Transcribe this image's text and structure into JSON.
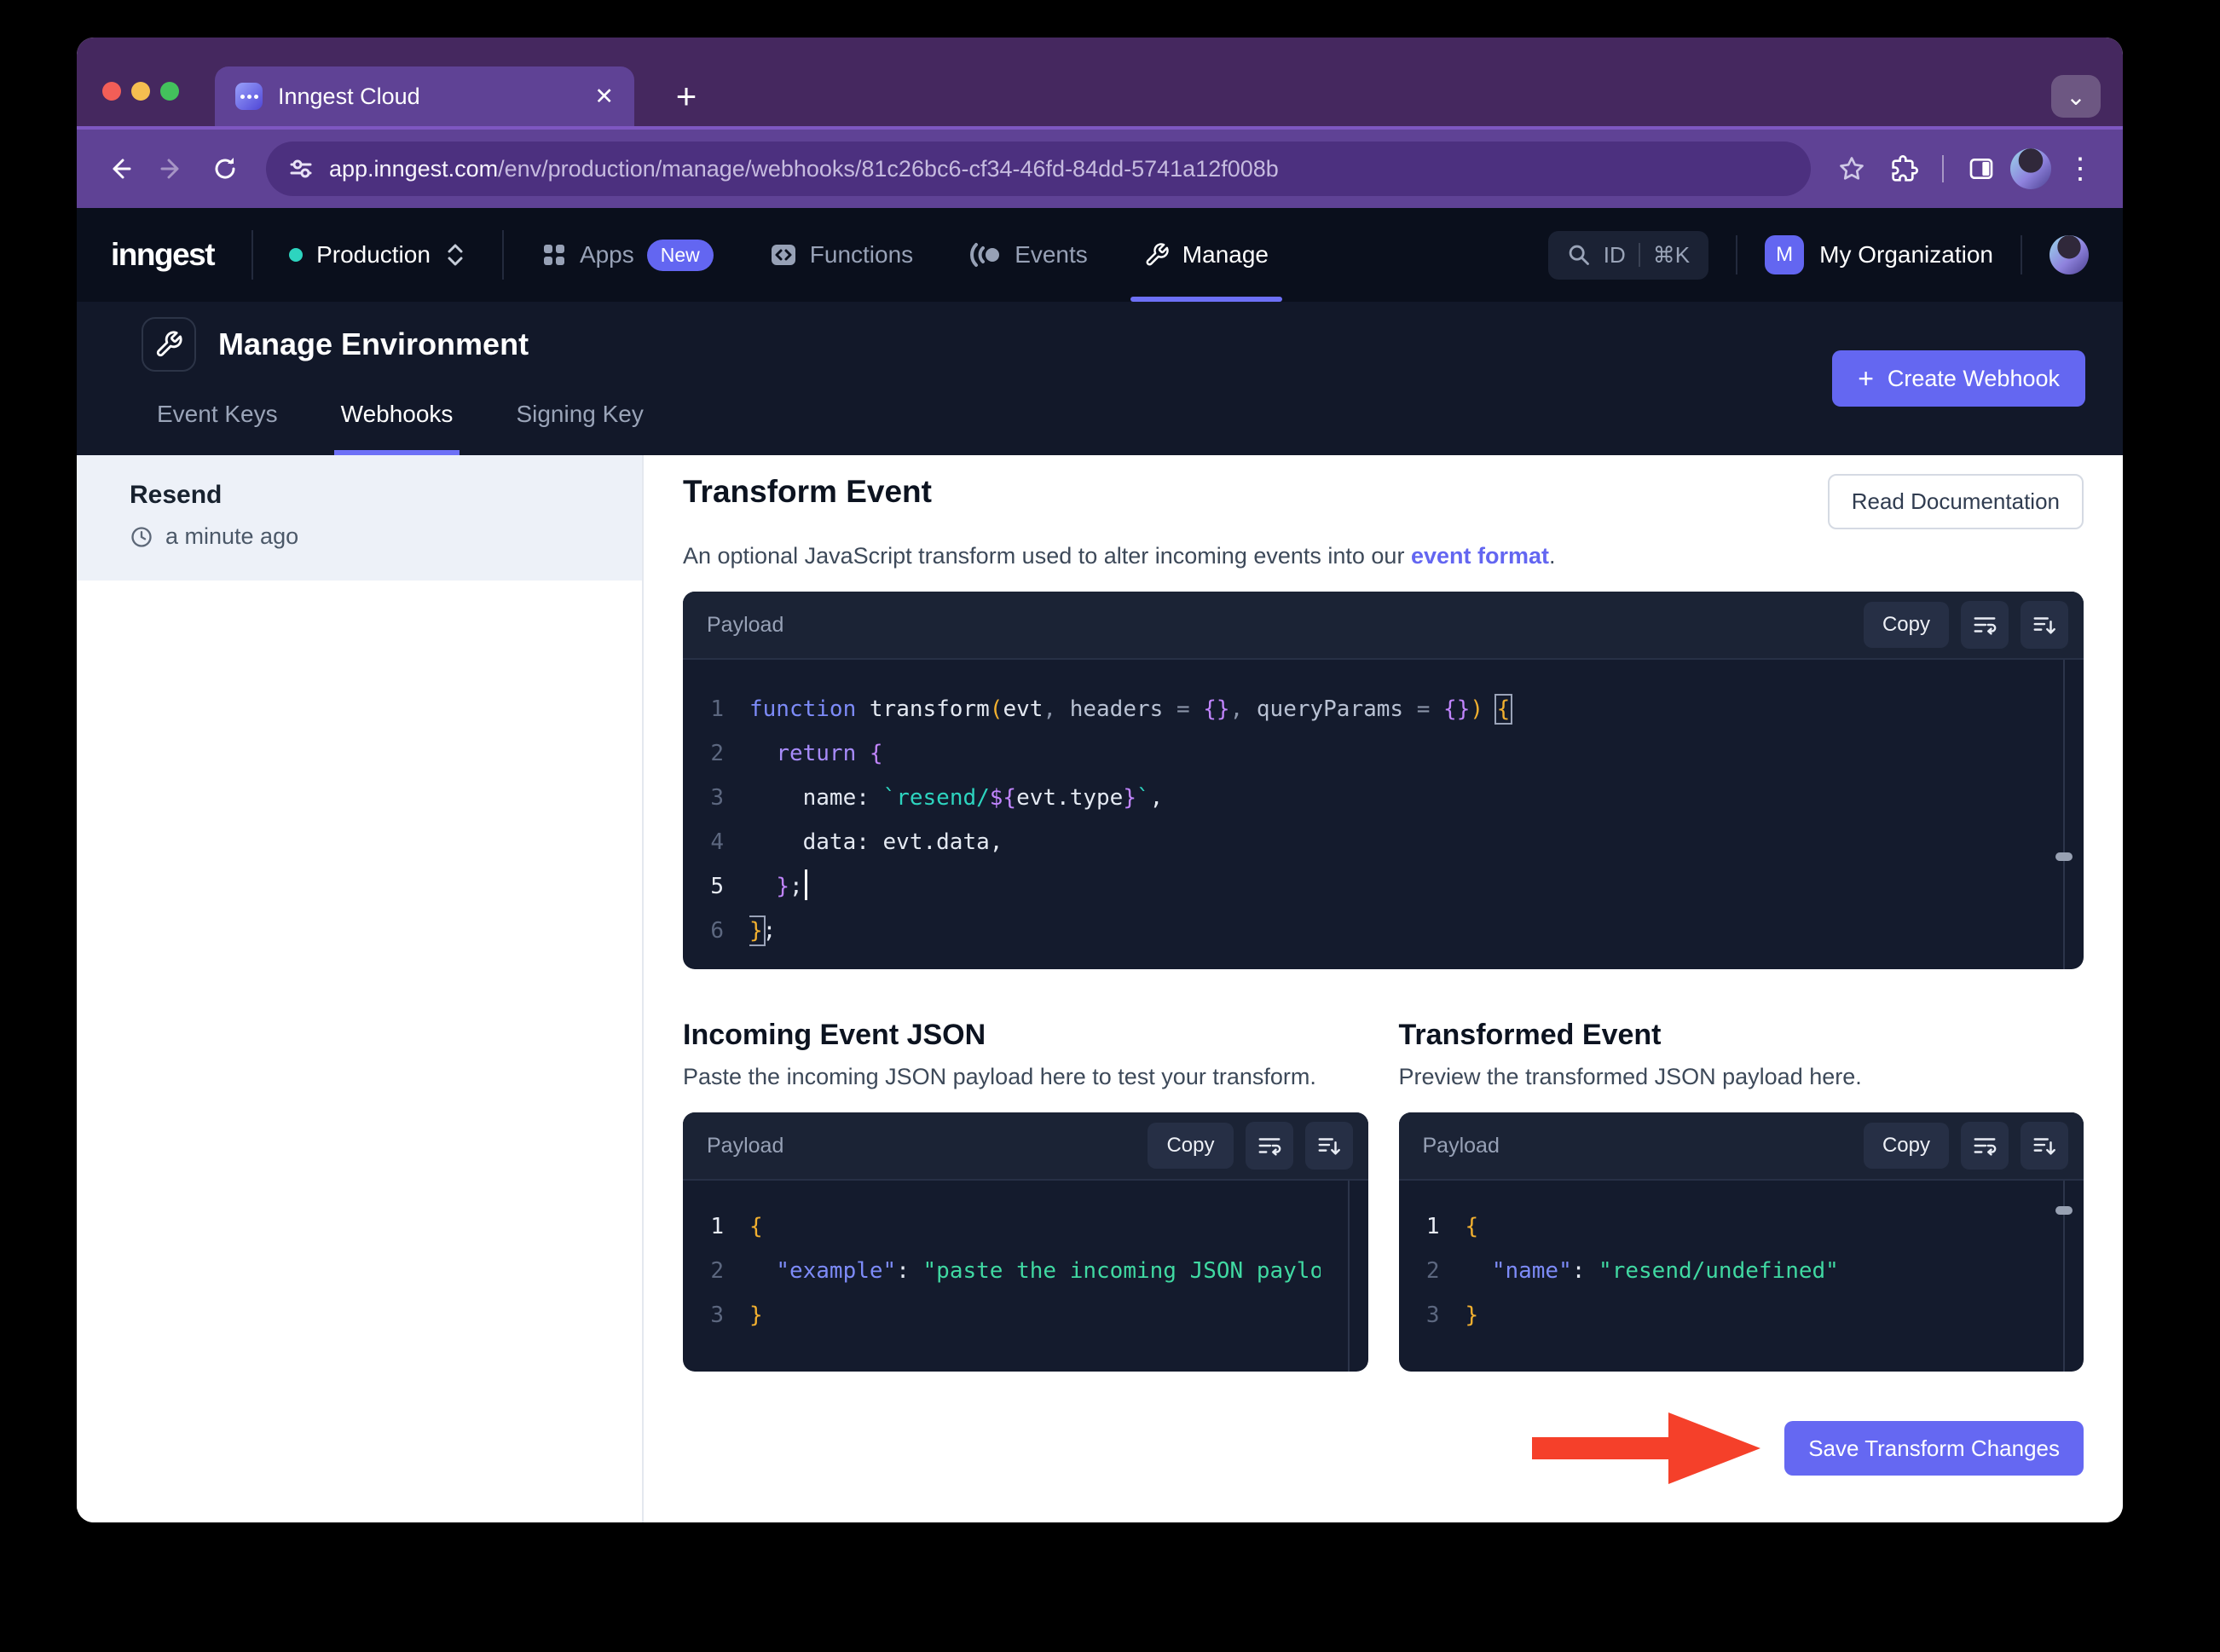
{
  "browser": {
    "tab": {
      "title": "Inngest Cloud",
      "close_glyph": "✕",
      "new_tab_glyph": "+",
      "tab_menu_glyph": "⌄",
      "menu_glyph": "⋮"
    },
    "url": {
      "host": "app.inngest.com",
      "path": "/env/production/manage/webhooks/81c26bc6-cf34-46fd-84dd-5741a12f008b"
    },
    "traffic_lights": {
      "red": "#f25e57",
      "yellow": "#f6be50",
      "green": "#43c15c"
    }
  },
  "nav": {
    "logo": "inngest",
    "environment": {
      "label": "Production",
      "dot_color": "#2dd4bf"
    },
    "items": [
      {
        "label": "Apps",
        "badge": "New"
      },
      {
        "label": "Functions"
      },
      {
        "label": "Events"
      },
      {
        "label": "Manage"
      }
    ],
    "search": {
      "id_label": "ID",
      "shortcut": "⌘K"
    },
    "org": {
      "initial": "M",
      "name": "My Organization"
    }
  },
  "header": {
    "title": "Manage Environment",
    "tabs": [
      {
        "label": "Event Keys"
      },
      {
        "label": "Webhooks"
      },
      {
        "label": "Signing Key"
      }
    ],
    "create_plus": "+",
    "create_button": "Create Webhook"
  },
  "sidebar": {
    "items": [
      {
        "name": "Resend",
        "time": "a minute ago"
      }
    ]
  },
  "transform": {
    "title": "Transform Event",
    "description_prefix": "An optional JavaScript transform used to alter incoming events into our ",
    "description_link": "event format",
    "description_suffix": ".",
    "read_docs": "Read Documentation"
  },
  "editor": {
    "label": "Payload",
    "copy": "Copy",
    "lines": [
      {
        "num": "1",
        "tokens": [
          {
            "t": "function",
            "c": "kw"
          },
          {
            "t": " transform",
            "c": "pl"
          },
          {
            "t": "(",
            "c": "am"
          },
          {
            "t": "evt",
            "c": "pl"
          },
          {
            "t": ", ",
            "c": "op"
          },
          {
            "t": "headers",
            "c": "pr"
          },
          {
            "t": " = ",
            "c": "op"
          },
          {
            "t": "{}",
            "c": "br"
          },
          {
            "t": ", ",
            "c": "op"
          },
          {
            "t": "queryParams",
            "c": "pr"
          },
          {
            "t": " = ",
            "c": "op"
          },
          {
            "t": "{}",
            "c": "br"
          },
          {
            "t": ")",
            "c": "am"
          },
          {
            "t": " ",
            "c": "pl"
          },
          {
            "t": "{",
            "c": "am",
            "box": true
          }
        ]
      },
      {
        "num": "2",
        "tokens": [
          {
            "t": "  ",
            "c": "pl"
          },
          {
            "t": "return",
            "c": "ret"
          },
          {
            "t": " ",
            "c": "pl"
          },
          {
            "t": "{",
            "c": "br"
          }
        ]
      },
      {
        "num": "3",
        "tokens": [
          {
            "t": "    name: ",
            "c": "pl"
          },
          {
            "t": "`resend/",
            "c": "st"
          },
          {
            "t": "${",
            "c": "br"
          },
          {
            "t": "evt.type",
            "c": "pl"
          },
          {
            "t": "}",
            "c": "br"
          },
          {
            "t": "`",
            "c": "st"
          },
          {
            "t": ",",
            "c": "pl"
          }
        ]
      },
      {
        "num": "4",
        "tokens": [
          {
            "t": "    data: evt.data,",
            "c": "pl"
          }
        ]
      },
      {
        "num": "5",
        "tokens": [
          {
            "t": "  ",
            "c": "pl"
          },
          {
            "t": "}",
            "c": "br"
          },
          {
            "t": ";",
            "c": "pl"
          },
          {
            "caret": true
          }
        ]
      },
      {
        "num": "6",
        "tokens": [
          {
            "t": "}",
            "c": "am",
            "box": true
          },
          {
            "t": ";",
            "c": "pl"
          }
        ]
      }
    ]
  },
  "incoming": {
    "title": "Incoming Event JSON",
    "subtitle": "Paste the incoming JSON payload here to test your transform.",
    "label": "Payload",
    "copy": "Copy",
    "lines": [
      {
        "num": "1",
        "tokens": [
          {
            "t": "{",
            "c": "am"
          }
        ]
      },
      {
        "num": "2",
        "tokens": [
          {
            "t": "  ",
            "c": "pl"
          },
          {
            "t": "\"example\"",
            "c": "ky"
          },
          {
            "t": ": ",
            "c": "pl"
          },
          {
            "t": "\"paste the incoming JSON paylo",
            "c": "gr"
          }
        ]
      },
      {
        "num": "3",
        "tokens": [
          {
            "t": "}",
            "c": "am"
          }
        ]
      }
    ]
  },
  "transformed": {
    "title": "Transformed Event",
    "subtitle": "Preview the transformed JSON payload here.",
    "label": "Payload",
    "copy": "Copy",
    "lines": [
      {
        "num": "1",
        "tokens": [
          {
            "t": "{",
            "c": "am"
          }
        ]
      },
      {
        "num": "2",
        "tokens": [
          {
            "t": "  ",
            "c": "pl"
          },
          {
            "t": "\"name\"",
            "c": "ky"
          },
          {
            "t": ": ",
            "c": "pl"
          },
          {
            "t": "\"resend/undefined\"",
            "c": "gr"
          }
        ]
      },
      {
        "num": "3",
        "tokens": [
          {
            "t": "}",
            "c": "am"
          }
        ]
      }
    ]
  },
  "save_button": "Save Transform Changes",
  "colors": {
    "accent_indigo": "#6366f1",
    "arrow_red": "#f5402a",
    "editor_bg": "#141b2d"
  }
}
